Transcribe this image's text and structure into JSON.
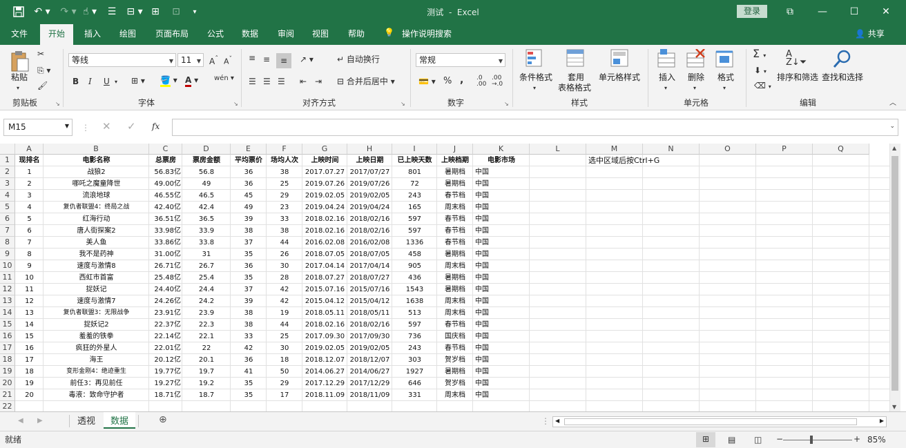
{
  "window": {
    "doc_title": "测试",
    "separator": "-",
    "app_name": "Excel",
    "login_label": "登录"
  },
  "tabs": [
    "文件",
    "开始",
    "插入",
    "绘图",
    "页面布局",
    "公式",
    "数据",
    "审阅",
    "视图",
    "帮助"
  ],
  "active_tab": "开始",
  "tell_me": "操作说明搜索",
  "share_label": "共享",
  "ribbon": {
    "clipboard": {
      "paste": "粘贴",
      "group": "剪贴板"
    },
    "font": {
      "name": "等线",
      "size": "11",
      "bold": "B",
      "italic": "I",
      "underline": "U",
      "group": "字体"
    },
    "alignment": {
      "wrap": "自动换行",
      "merge": "合并后居中",
      "group": "对齐方式"
    },
    "number": {
      "format": "常规",
      "percent": "%",
      "comma": ",",
      "group": "数字"
    },
    "styles": {
      "conditional": "条件格式",
      "table_line1": "套用",
      "table_line2": "表格格式",
      "cell_styles": "单元格样式",
      "group": "样式"
    },
    "cells": {
      "insert": "插入",
      "delete": "删除",
      "format": "格式",
      "group": "单元格"
    },
    "editing": {
      "sort": "排序和筛选",
      "find": "查找和选择",
      "group": "编辑"
    }
  },
  "formula": {
    "name_box": "M15",
    "fx": "fx",
    "content": ""
  },
  "columns": [
    "A",
    "B",
    "C",
    "D",
    "E",
    "F",
    "G",
    "H",
    "I",
    "J",
    "K",
    "L",
    "M",
    "N",
    "O",
    "P",
    "Q"
  ],
  "row_numbers": [
    "1",
    "2",
    "3",
    "4",
    "5",
    "6",
    "7",
    "8",
    "9",
    "10",
    "11",
    "12",
    "13",
    "14",
    "15",
    "16",
    "17",
    "18",
    "19",
    "20",
    "21",
    "22"
  ],
  "headers": [
    "现排名",
    "电影名称",
    "总票房",
    "票房金额",
    "平均票价",
    "场均人次",
    "上映时间",
    "上映日期",
    "已上映天数",
    "上映档期",
    "电影市场"
  ],
  "note": "选中区域后按Ctrl+G",
  "rows": [
    [
      "1",
      "战狼2",
      "56.83亿",
      "56.8",
      "36",
      "38",
      "2017.07.27",
      "2017/07/27",
      "801",
      "暑期档",
      "中国"
    ],
    [
      "2",
      "哪吒之魔童降世",
      "49.00亿",
      "49",
      "36",
      "25",
      "2019.07.26",
      "2019/07/26",
      "72",
      "暑期档",
      "中国"
    ],
    [
      "3",
      "流浪地球",
      "46.55亿",
      "46.5",
      "45",
      "29",
      "2019.02.05",
      "2019/02/05",
      "243",
      "春节档",
      "中国"
    ],
    [
      "4",
      "复仇者联盟4：终局之战",
      "42.40亿",
      "42.4",
      "49",
      "23",
      "2019.04.24",
      "2019/04/24",
      "165",
      "周末档",
      "中国"
    ],
    [
      "5",
      "红海行动",
      "36.51亿",
      "36.5",
      "39",
      "33",
      "2018.02.16",
      "2018/02/16",
      "597",
      "春节档",
      "中国"
    ],
    [
      "6",
      "唐人街探案2",
      "33.98亿",
      "33.9",
      "38",
      "38",
      "2018.02.16",
      "2018/02/16",
      "597",
      "春节档",
      "中国"
    ],
    [
      "7",
      "美人鱼",
      "33.86亿",
      "33.8",
      "37",
      "44",
      "2016.02.08",
      "2016/02/08",
      "1336",
      "春节档",
      "中国"
    ],
    [
      "8",
      "我不是药神",
      "31.00亿",
      "31",
      "35",
      "26",
      "2018.07.05",
      "2018/07/05",
      "458",
      "暑期档",
      "中国"
    ],
    [
      "9",
      "速度与激情8",
      "26.71亿",
      "26.7",
      "36",
      "30",
      "2017.04.14",
      "2017/04/14",
      "905",
      "周末档",
      "中国"
    ],
    [
      "10",
      "西虹市首富",
      "25.48亿",
      "25.4",
      "35",
      "28",
      "2018.07.27",
      "2018/07/27",
      "436",
      "暑期档",
      "中国"
    ],
    [
      "11",
      "捉妖记",
      "24.40亿",
      "24.4",
      "37",
      "42",
      "2015.07.16",
      "2015/07/16",
      "1543",
      "暑期档",
      "中国"
    ],
    [
      "12",
      "速度与激情7",
      "24.26亿",
      "24.2",
      "39",
      "42",
      "2015.04.12",
      "2015/04/12",
      "1638",
      "周末档",
      "中国"
    ],
    [
      "13",
      "复仇者联盟3：无限战争",
      "23.91亿",
      "23.9",
      "38",
      "19",
      "2018.05.11",
      "2018/05/11",
      "513",
      "周末档",
      "中国"
    ],
    [
      "14",
      "捉妖记2",
      "22.37亿",
      "22.3",
      "38",
      "44",
      "2018.02.16",
      "2018/02/16",
      "597",
      "春节档",
      "中国"
    ],
    [
      "15",
      "羞羞的铁拳",
      "22.14亿",
      "22.1",
      "33",
      "25",
      "2017.09.30",
      "2017/09/30",
      "736",
      "国庆档",
      "中国"
    ],
    [
      "16",
      "疯狂的外星人",
      "22.01亿",
      "22",
      "42",
      "30",
      "2019.02.05",
      "2019/02/05",
      "243",
      "春节档",
      "中国"
    ],
    [
      "17",
      "海王",
      "20.12亿",
      "20.1",
      "36",
      "18",
      "2018.12.07",
      "2018/12/07",
      "303",
      "贺岁档",
      "中国"
    ],
    [
      "18",
      "变形金刚4：绝迹重生",
      "19.77亿",
      "19.7",
      "41",
      "50",
      "2014.06.27",
      "2014/06/27",
      "1927",
      "暑期档",
      "中国"
    ],
    [
      "19",
      "前任3：再见前任",
      "19.27亿",
      "19.2",
      "35",
      "29",
      "2017.12.29",
      "2017/12/29",
      "646",
      "贺岁档",
      "中国"
    ],
    [
      "20",
      "毒液：致命守护者",
      "18.71亿",
      "18.7",
      "35",
      "17",
      "2018.11.09",
      "2018/11/09",
      "331",
      "周末档",
      "中国"
    ]
  ],
  "sheets": [
    "透视",
    "数据"
  ],
  "active_sheet": "数据",
  "status": {
    "mode": "就绪",
    "zoom": "85%"
  },
  "accent": "#217346"
}
